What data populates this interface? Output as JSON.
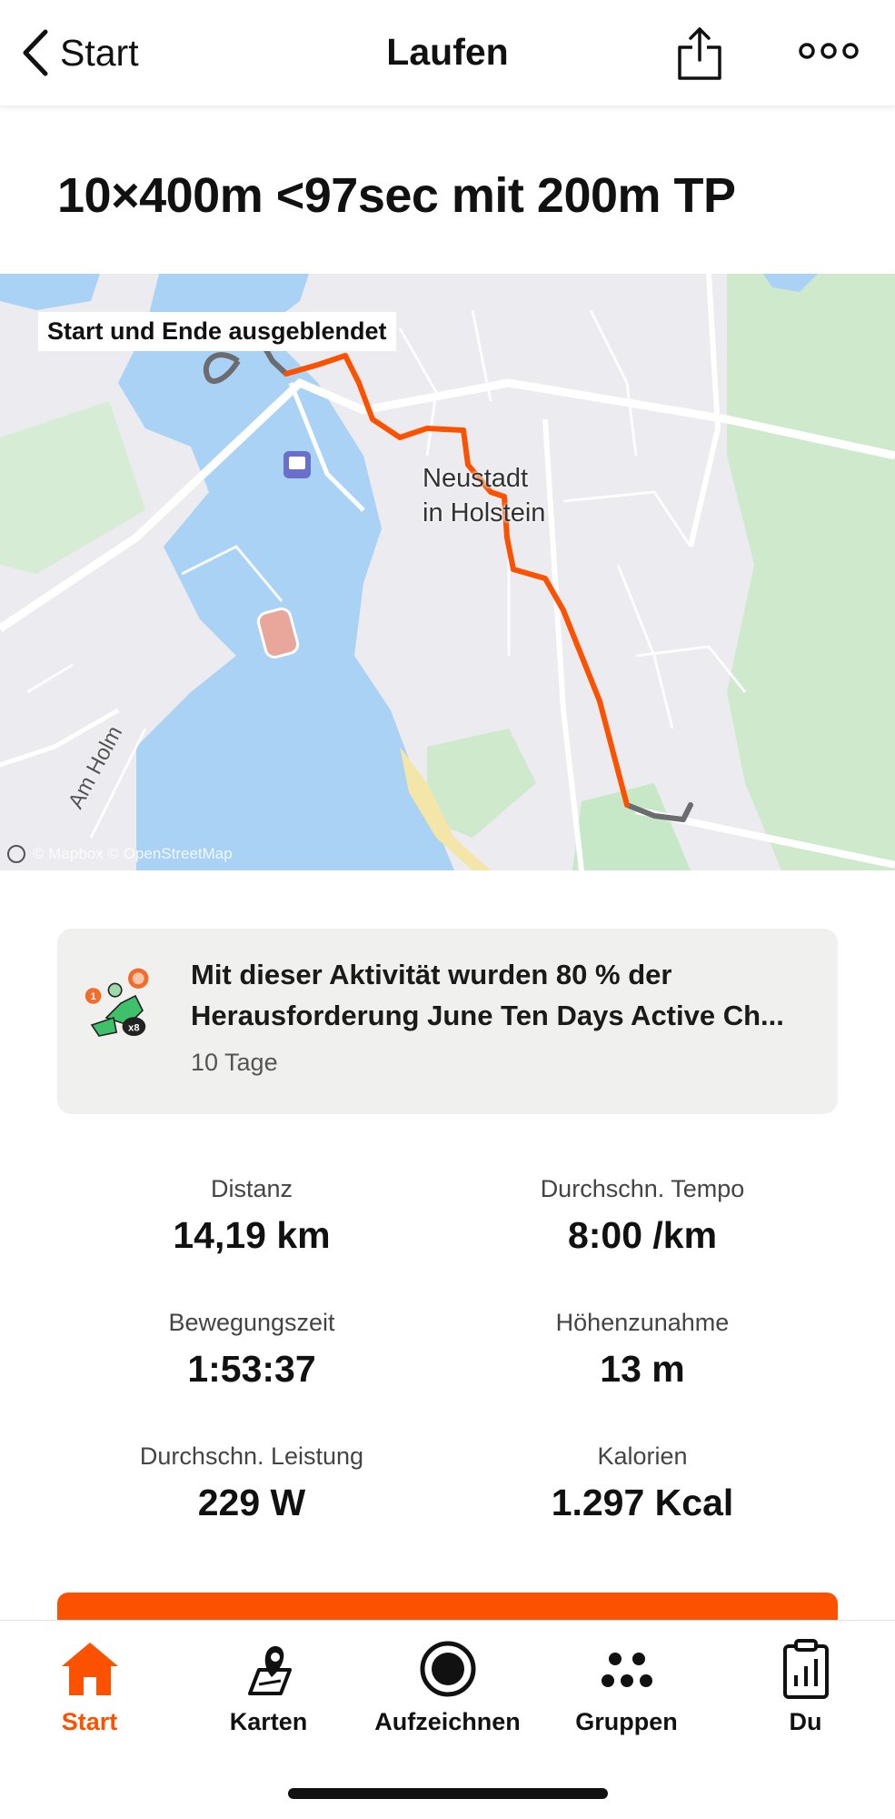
{
  "header": {
    "back_label": "Start",
    "title": "Laufen"
  },
  "activity": {
    "title": "10×400m <97sec mit 200m TP"
  },
  "map": {
    "notice": "Start und Ende ausgeblendet",
    "town_label_line1": "Neustadt",
    "town_label_line2": "in Holstein",
    "road_label": "Am Holm",
    "attribution": "© Mapbox © OpenStreetMap",
    "route_color": "#fc5200",
    "hidden_route_color": "#6b6b70",
    "water_color": "#a9d2f5",
    "park_color": "#c7e8c6"
  },
  "challenge": {
    "line1": "Mit dieser Aktivität wurden 80 % der",
    "line2": "Herausforderung June Ten Days Active Ch...",
    "duration": "10 Tage",
    "badge_number": "1",
    "badge_multiplier": "x8"
  },
  "stats": [
    {
      "label": "Distanz",
      "value": "14,19 km"
    },
    {
      "label": "Durchschn. Tempo",
      "value": "8:00 /km"
    },
    {
      "label": "Bewegungszeit",
      "value": "1:53:37"
    },
    {
      "label": "Höhenzunahme",
      "value": "13 m"
    },
    {
      "label": "Durchschn. Leistung",
      "value": "229 W"
    },
    {
      "label": "Kalorien",
      "value": "1.297 Kcal"
    }
  ],
  "nav": [
    {
      "label": "Start",
      "icon": "home-icon",
      "active": true
    },
    {
      "label": "Karten",
      "icon": "map-pin-icon",
      "active": false
    },
    {
      "label": "Aufzeichnen",
      "icon": "record-icon",
      "active": false
    },
    {
      "label": "Gruppen",
      "icon": "groups-icon",
      "active": false
    },
    {
      "label": "Du",
      "icon": "profile-stats-icon",
      "active": false
    }
  ],
  "colors": {
    "accent": "#fc5200",
    "card_bg": "#f0f0ef"
  }
}
